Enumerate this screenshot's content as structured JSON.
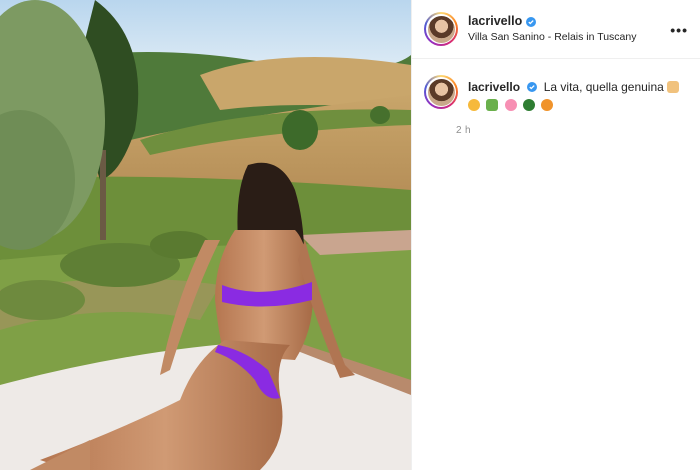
{
  "post": {
    "image_alt": "Photo post",
    "author": {
      "username": "lacrivello",
      "verified": true,
      "location": "Villa San Sanino - Relais in Tuscany"
    },
    "caption": {
      "username": "lacrivello",
      "text": "La vita, quella genuina",
      "emojis": [
        "woman-farmer-emoji",
        "smiling-face-emoji",
        "seedling-hand-emoji",
        "hibiscus-emoji",
        "tree-emoji",
        "peach-emoji"
      ]
    },
    "timestamp": "2 h",
    "more_label": "•••"
  },
  "colors": {
    "verified_blue": "#3897f0",
    "bikini_purple": "#8a2be2"
  }
}
